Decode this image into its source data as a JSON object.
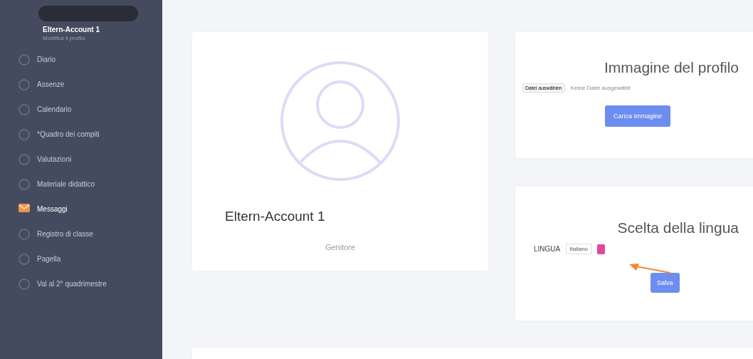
{
  "sidebar": {
    "user": {
      "name": "Eltern-Account 1",
      "link": "Modifica il profilo"
    },
    "items": [
      {
        "label": "Diario",
        "kind": "circle",
        "selected": false
      },
      {
        "label": "Assenze",
        "kind": "circle",
        "selected": false
      },
      {
        "label": "Calendario",
        "kind": "circle",
        "selected": false
      },
      {
        "label": "*Quadro dei compiti",
        "kind": "circle",
        "selected": false
      },
      {
        "label": "Valutazioni",
        "kind": "circle",
        "selected": false
      },
      {
        "label": "Materiale didattico",
        "kind": "circle",
        "selected": false
      },
      {
        "label": "Messaggi",
        "kind": "envelope",
        "selected": true
      },
      {
        "label": "Registro di classe",
        "kind": "circle",
        "selected": false
      },
      {
        "label": "Pagella",
        "kind": "circle",
        "selected": false
      },
      {
        "label": "Val al 2° quadrimestre",
        "kind": "circle",
        "selected": false
      }
    ]
  },
  "profile": {
    "name": "Eltern-Account 1",
    "role": "Genitore"
  },
  "image_card": {
    "title": "Immagine del profilo",
    "file_button": "Datei auswählen",
    "file_status": "Keine Datei ausgewählt",
    "upload_button": "Carica Immagine"
  },
  "language_card": {
    "title": "Scelta della lingua",
    "label": "LINGUA",
    "value": "Italiano",
    "save_button": "Salva"
  }
}
